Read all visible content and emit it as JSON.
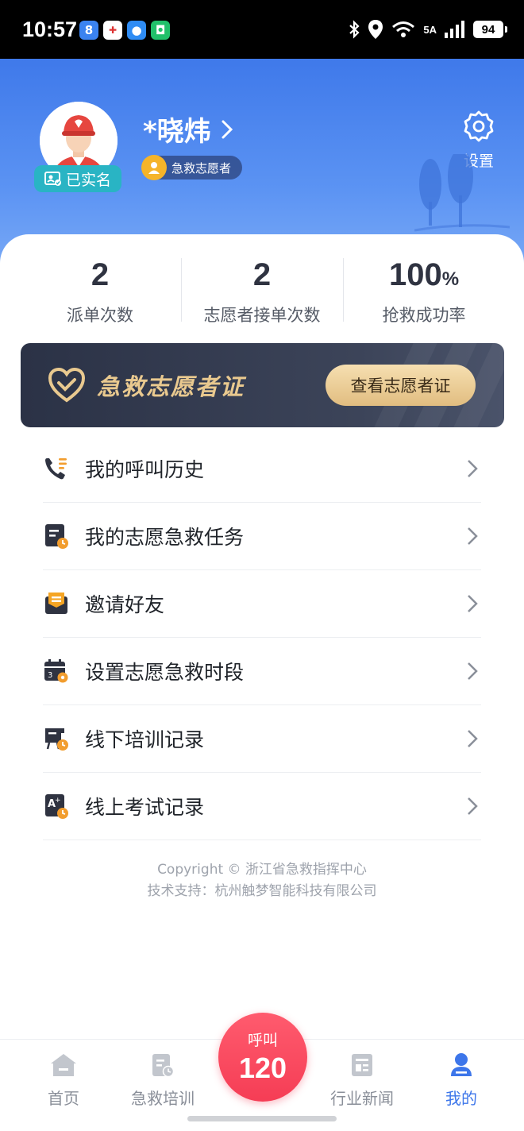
{
  "status_bar": {
    "time": "10:57",
    "network": "5A",
    "battery": "94",
    "notification_icons": [
      "app-8-icon",
      "hospital-app-icon",
      "message-app-icon",
      "wechat-app-icon"
    ]
  },
  "profile": {
    "name": "*晓炜",
    "verified_label": "已实名",
    "role_badge": "急救志愿者",
    "settings_label": "设置"
  },
  "stats": [
    {
      "value": "2",
      "unit": "",
      "label": "派单次数"
    },
    {
      "value": "2",
      "unit": "",
      "label": "志愿者接单次数"
    },
    {
      "value": "100",
      "unit": "%",
      "label": "抢救成功率"
    }
  ],
  "volunteer_card": {
    "title": "急救志愿者证",
    "button": "查看志愿者证"
  },
  "menu": [
    {
      "label": "我的呼叫历史",
      "icon": "phone-list-icon"
    },
    {
      "label": "我的志愿急救任务",
      "icon": "task-clock-icon"
    },
    {
      "label": "邀请好友",
      "icon": "invite-bag-icon"
    },
    {
      "label": "设置志愿急救时段",
      "icon": "calendar-gear-icon"
    },
    {
      "label": "线下培训记录",
      "icon": "training-board-icon"
    },
    {
      "label": "线上考试记录",
      "icon": "exam-record-icon"
    }
  ],
  "footer": {
    "copyright": "Copyright © 浙江省急救指挥中心",
    "support": "技术支持：杭州触梦智能科技有限公司"
  },
  "bottom_nav": {
    "home": "首页",
    "training": "急救培训",
    "call_top": "呼叫",
    "call_number": "120",
    "news": "行业新闻",
    "mine": "我的",
    "active": "mine"
  },
  "colors": {
    "primary": "#3d76ea",
    "call": "#f53d55",
    "gold": "#e9c98f",
    "card_dark": "#2b3246"
  }
}
